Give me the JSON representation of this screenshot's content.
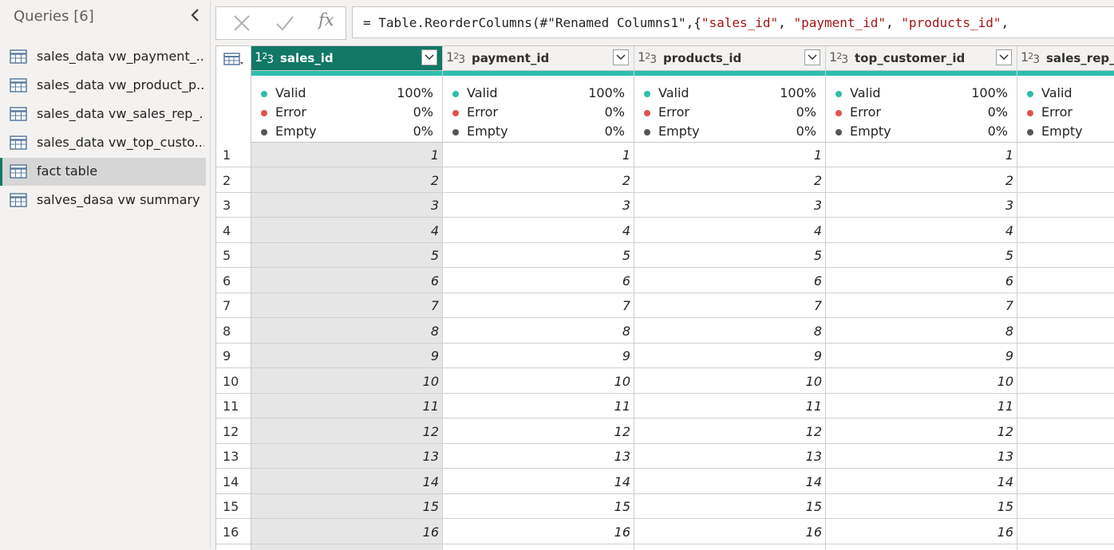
{
  "queries": {
    "title": "Queries [6]",
    "items": [
      {
        "label": "sales_data vw_payment_..."
      },
      {
        "label": "sales_data vw_product_p..."
      },
      {
        "label": "sales_data vw_sales_rep_..."
      },
      {
        "label": "sales_data vw_top_custo..."
      },
      {
        "label": "fact table",
        "selected": true
      },
      {
        "label": "salves_dasa vw summary"
      }
    ]
  },
  "formula": {
    "fx": "fx",
    "prefix": "= Table.ReorderColumns(#\"Renamed Columns1\",{",
    "s1": "\"sales_id\"",
    "sep1": ", ",
    "s2": "\"payment_id\"",
    "sep2": ", ",
    "s3": "\"products_id\"",
    "suffix": ","
  },
  "quality_labels": {
    "valid": "Valid",
    "error": "Error",
    "empty": "Empty"
  },
  "colors": {
    "valid": "#2dbeab",
    "error": "#e5504d",
    "empty": "#555555",
    "accent": "#117865"
  },
  "type_icon": {
    "a": "1",
    "b": "2",
    "c": "3"
  },
  "columns": [
    {
      "name": "sales_id",
      "valid": "100%",
      "error": "0%",
      "empty": "0%",
      "selected": true
    },
    {
      "name": "payment_id",
      "valid": "100%",
      "error": "0%",
      "empty": "0%"
    },
    {
      "name": "products_id",
      "valid": "100%",
      "error": "0%",
      "empty": "0%"
    },
    {
      "name": "top_customer_id",
      "valid": "100%",
      "error": "0%",
      "empty": "0%"
    },
    {
      "name": "sales_rep_i",
      "valid": "",
      "error": "",
      "empty": "",
      "partial": true
    }
  ],
  "rows": [
    "1",
    "2",
    "3",
    "4",
    "5",
    "6",
    "7",
    "8",
    "9",
    "10",
    "11",
    "12",
    "13",
    "14",
    "15",
    "16"
  ]
}
